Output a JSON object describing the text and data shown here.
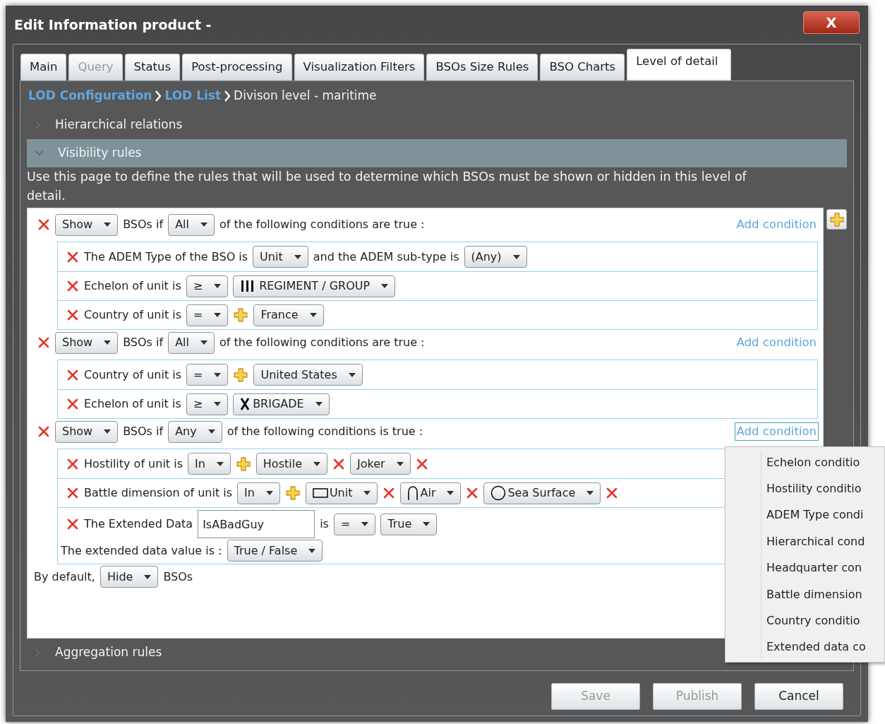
{
  "window": {
    "title": "Edit Information product -",
    "close_label": "X"
  },
  "tabs": [
    {
      "label": "Main",
      "selected": false,
      "disabled": false
    },
    {
      "label": "Query",
      "selected": false,
      "disabled": true
    },
    {
      "label": "Status",
      "selected": false,
      "disabled": false
    },
    {
      "label": "Post-processing",
      "selected": false,
      "disabled": false
    },
    {
      "label": "Visualization Filters",
      "selected": false,
      "disabled": false
    },
    {
      "label": "BSOs Size Rules",
      "selected": false,
      "disabled": false
    },
    {
      "label": "BSO Charts",
      "selected": false,
      "disabled": false
    },
    {
      "label": "Level of detail",
      "selected": true,
      "disabled": false
    }
  ],
  "breadcrumb": [
    {
      "text": "LOD Configuration",
      "kind": "link"
    },
    {
      "text": "LOD List",
      "kind": "link"
    },
    {
      "text": "Divison level - maritime",
      "kind": "current"
    }
  ],
  "sections": [
    {
      "label": "Hierarchical relations",
      "expanded": false
    },
    {
      "label": "Visibility rules",
      "expanded": true,
      "description": "Use this page to define the rules that will be used to determine which BSOs must be shown or hidden in this level of detail.",
      "groups": [
        {
          "header": [
            {
              "kind": "remove"
            },
            {
              "kind": "dropdown",
              "value": "Show"
            },
            {
              "kind": "text",
              "text": "BSOs if"
            },
            {
              "kind": "dropdown",
              "value": "All"
            },
            {
              "kind": "text",
              "text": "of the following conditions are true :"
            }
          ],
          "add_condition": {
            "label": "Add condition",
            "focused": false
          },
          "conditions": [
            {
              "lines": [
                [
                  {
                    "kind": "remove"
                  },
                  {
                    "kind": "text",
                    "text": "The ADEM Type of the BSO is"
                  },
                  {
                    "kind": "dropdown",
                    "value": "Unit"
                  },
                  {
                    "kind": "text",
                    "text": "and the ADEM sub-type is"
                  },
                  {
                    "kind": "dropdown",
                    "value": "(Any)"
                  }
                ]
              ]
            },
            {
              "lines": [
                [
                  {
                    "kind": "remove"
                  },
                  {
                    "kind": "text",
                    "text": "Echelon of unit is"
                  },
                  {
                    "kind": "dropdown",
                    "value": "≥"
                  },
                  {
                    "kind": "regiment",
                    "value": "REGIMENT / GROUP"
                  }
                ]
              ]
            },
            {
              "lines": [
                [
                  {
                    "kind": "remove"
                  },
                  {
                    "kind": "text",
                    "text": "Country of unit is"
                  },
                  {
                    "kind": "dropdown",
                    "value": "="
                  },
                  {
                    "kind": "add"
                  },
                  {
                    "kind": "dropdown",
                    "value": "France"
                  }
                ]
              ]
            }
          ]
        },
        {
          "header": [
            {
              "kind": "remove"
            },
            {
              "kind": "dropdown",
              "value": "Show"
            },
            {
              "kind": "text",
              "text": "BSOs if"
            },
            {
              "kind": "dropdown",
              "value": "All"
            },
            {
              "kind": "text",
              "text": "of the following conditions are true :"
            }
          ],
          "add_condition": {
            "label": "Add condition",
            "focused": false
          },
          "conditions": [
            {
              "lines": [
                [
                  {
                    "kind": "remove"
                  },
                  {
                    "kind": "text",
                    "text": "Country of unit is"
                  },
                  {
                    "kind": "dropdown",
                    "value": "="
                  },
                  {
                    "kind": "add"
                  },
                  {
                    "kind": "dropdown",
                    "value": "United States"
                  }
                ]
              ]
            },
            {
              "lines": [
                [
                  {
                    "kind": "remove"
                  },
                  {
                    "kind": "text",
                    "text": "Echelon of unit is"
                  },
                  {
                    "kind": "dropdown",
                    "value": "≥"
                  },
                  {
                    "kind": "brigade",
                    "value": "BRIGADE"
                  }
                ]
              ]
            }
          ]
        },
        {
          "header": [
            {
              "kind": "remove"
            },
            {
              "kind": "dropdown",
              "value": "Show"
            },
            {
              "kind": "text",
              "text": "BSOs if"
            },
            {
              "kind": "dropdown",
              "value": "Any"
            },
            {
              "kind": "text",
              "text": "of the following conditions is true :"
            }
          ],
          "add_condition": {
            "label": "Add condition",
            "focused": true
          },
          "conditions": [
            {
              "lines": [
                [
                  {
                    "kind": "remove"
                  },
                  {
                    "kind": "text",
                    "text": "Hostility of unit is"
                  },
                  {
                    "kind": "dropdown",
                    "value": "In"
                  },
                  {
                    "kind": "add"
                  },
                  {
                    "kind": "dropdown",
                    "value": "Hostile"
                  },
                  {
                    "kind": "remove"
                  },
                  {
                    "kind": "dropdown",
                    "value": "Joker"
                  },
                  {
                    "kind": "remove"
                  }
                ]
              ]
            },
            {
              "lines": [
                [
                  {
                    "kind": "remove"
                  },
                  {
                    "kind": "text",
                    "text": "Battle dimension of unit is"
                  },
                  {
                    "kind": "dropdown",
                    "value": "In"
                  },
                  {
                    "kind": "add"
                  },
                  {
                    "kind": "ground",
                    "value": "Unit"
                  },
                  {
                    "kind": "remove"
                  },
                  {
                    "kind": "air",
                    "value": "Air"
                  },
                  {
                    "kind": "remove"
                  },
                  {
                    "kind": "sea",
                    "value": "Sea Surface"
                  },
                  {
                    "kind": "remove"
                  }
                ]
              ]
            },
            {
              "lines": [
                [
                  {
                    "kind": "remove"
                  },
                  {
                    "kind": "text",
                    "text": "The Extended Data"
                  },
                  {
                    "kind": "input",
                    "value": "IsABadGuy"
                  },
                  {
                    "kind": "text",
                    "text": "is"
                  },
                  {
                    "kind": "dropdown",
                    "value": "="
                  },
                  {
                    "kind": "dropdown",
                    "value": "True"
                  }
                ],
                [
                  {
                    "kind": "text",
                    "text": "The extended data value is :"
                  },
                  {
                    "kind": "dropdown",
                    "value": "True / False"
                  }
                ]
              ]
            }
          ]
        }
      ],
      "default": [
        {
          "kind": "text",
          "text": "By default,"
        },
        {
          "kind": "dropdown",
          "value": "Hide"
        },
        {
          "kind": "text",
          "text": "BSOs"
        }
      ]
    },
    {
      "label": "Aggregation rules",
      "expanded": false
    }
  ],
  "menu": {
    "items": [
      "Echelon conditio",
      "Hostility conditio",
      "ADEM Type condi",
      "Hierarchical cond",
      "Headquarter con",
      "Battle dimension",
      "Country conditio",
      "Extended data co"
    ]
  },
  "buttons": [
    {
      "label": "Save",
      "disabled": true
    },
    {
      "label": "Publish",
      "disabled": true
    },
    {
      "label": "Cancel",
      "disabled": false
    }
  ]
}
